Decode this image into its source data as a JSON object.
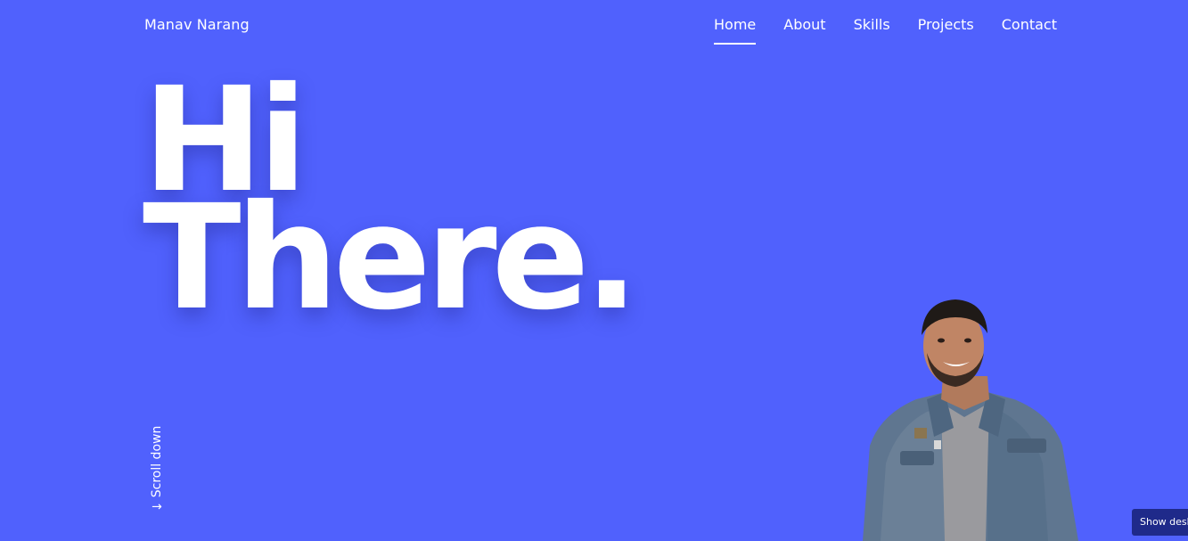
{
  "header": {
    "brand": "Manav Narang",
    "nav": [
      {
        "label": "Home",
        "active": true
      },
      {
        "label": "About",
        "active": false
      },
      {
        "label": "Skills",
        "active": false
      },
      {
        "label": "Projects",
        "active": false
      },
      {
        "label": "Contact",
        "active": false
      }
    ]
  },
  "hero": {
    "line1": "Hi",
    "line2": "There."
  },
  "scroll": {
    "arrow": "←",
    "label": "Scroll down"
  },
  "portrait": {
    "icon": "person-photo"
  },
  "toast": {
    "label": "Show desk"
  },
  "colors": {
    "background": "#5061fd",
    "text": "#ffffff",
    "toast": "#1f2a8a"
  }
}
